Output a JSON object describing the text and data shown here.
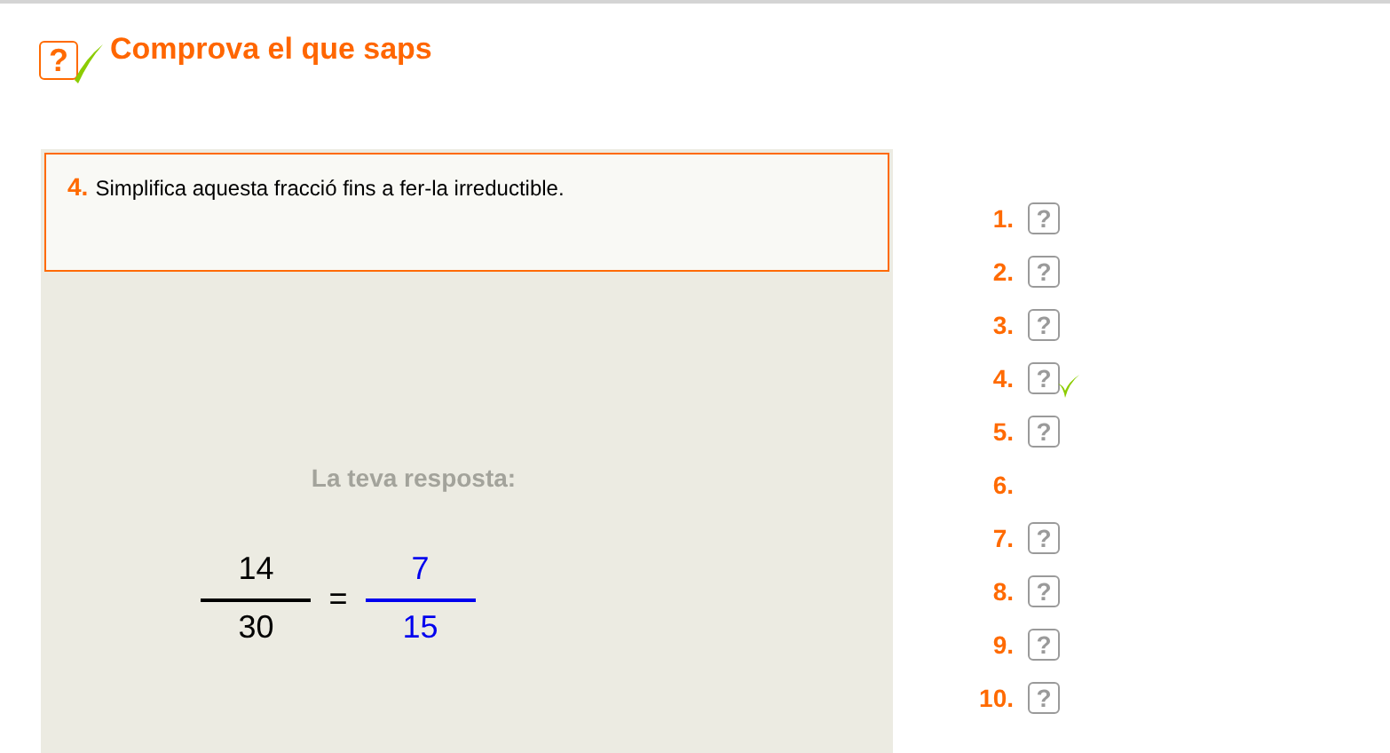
{
  "header": {
    "icon": "?",
    "title": "Comprova el que saps"
  },
  "question": {
    "number": "4.",
    "text": "Simplifica aquesta fracció fins a fer-la irreductible."
  },
  "answer": {
    "label": "La teva resposta:",
    "given": {
      "numerator": "14",
      "denominator": "30"
    },
    "equals": "=",
    "response": {
      "numerator": "7",
      "denominator": "15"
    }
  },
  "questions": [
    {
      "number": "1.",
      "icon": "?",
      "checked": false
    },
    {
      "number": "2.",
      "icon": "?",
      "checked": false
    },
    {
      "number": "3.",
      "icon": "?",
      "checked": false
    },
    {
      "number": "4.",
      "icon": "?",
      "checked": true
    },
    {
      "number": "5.",
      "icon": "?",
      "checked": false
    },
    {
      "number": "6.",
      "checked": false
    },
    {
      "number": "7.",
      "icon": "?",
      "checked": false
    },
    {
      "number": "8.",
      "icon": "?",
      "checked": false
    },
    {
      "number": "9.",
      "icon": "?",
      "checked": false
    },
    {
      "number": "10.",
      "icon": "?",
      "checked": false
    }
  ]
}
